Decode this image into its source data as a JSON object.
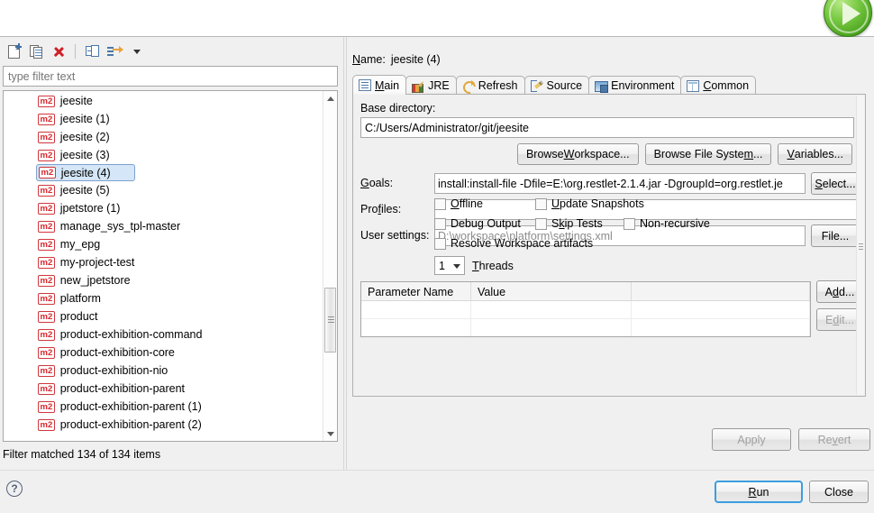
{
  "window": {
    "run_badge_icon": "green-run-play-icon"
  },
  "left_panel": {
    "toolbar": [
      {
        "name": "new-launch-configuration",
        "icon": "new-page-icon"
      },
      {
        "name": "duplicate-launch-configuration",
        "icon": "duplicate-icon"
      },
      {
        "name": "delete-launch-configuration",
        "icon": "delete-x-icon"
      },
      {
        "name": "collapse-all",
        "icon": "collapse-all-icon"
      },
      {
        "name": "filter-launch-configurations",
        "icon": "filter-arrow-icon"
      },
      {
        "name": "view-menu",
        "icon": "chevron-down-icon"
      }
    ],
    "filter": {
      "placeholder": "type filter text",
      "value": ""
    },
    "tree_items": [
      {
        "icon": "m2",
        "label": "jeesite",
        "selected": false
      },
      {
        "icon": "m2",
        "label": "jeesite (1)",
        "selected": false
      },
      {
        "icon": "m2",
        "label": "jeesite (2)",
        "selected": false
      },
      {
        "icon": "m2",
        "label": "jeesite (3)",
        "selected": false
      },
      {
        "icon": "m2",
        "label": "jeesite (4)",
        "selected": true
      },
      {
        "icon": "m2",
        "label": "jeesite (5)",
        "selected": false
      },
      {
        "icon": "m2",
        "label": "jpetstore (1)",
        "selected": false
      },
      {
        "icon": "m2",
        "label": "manage_sys_tpl-master",
        "selected": false
      },
      {
        "icon": "m2",
        "label": "my_epg",
        "selected": false
      },
      {
        "icon": "m2",
        "label": "my-project-test",
        "selected": false
      },
      {
        "icon": "m2",
        "label": "new_jpetstore",
        "selected": false
      },
      {
        "icon": "m2",
        "label": "platform",
        "selected": false
      },
      {
        "icon": "m2",
        "label": "product",
        "selected": false
      },
      {
        "icon": "m2",
        "label": "product-exhibition-command",
        "selected": false
      },
      {
        "icon": "m2",
        "label": "product-exhibition-core",
        "selected": false
      },
      {
        "icon": "m2",
        "label": "product-exhibition-nio",
        "selected": false
      },
      {
        "icon": "m2",
        "label": "product-exhibition-parent",
        "selected": false
      },
      {
        "icon": "m2",
        "label": "product-exhibition-parent (1)",
        "selected": false
      },
      {
        "icon": "m2",
        "label": "product-exhibition-parent (2)",
        "selected": false
      }
    ],
    "filter_status": "Filter matched 134 of 134 items"
  },
  "right_panel": {
    "name_label": "Name:",
    "name_value": "jeesite (4)",
    "tabs": [
      {
        "label": "Main",
        "icon": "main-clipboard-icon",
        "active": true
      },
      {
        "label": "JRE",
        "icon": "jre-books-icon",
        "active": false
      },
      {
        "label": "Refresh",
        "icon": "refresh-arrows-icon",
        "active": false
      },
      {
        "label": "Source",
        "icon": "source-pencil-icon",
        "active": false
      },
      {
        "label": "Environment",
        "icon": "environment-monitor-icon",
        "active": false
      },
      {
        "label": "Common",
        "icon": "common-table-icon",
        "active": false
      }
    ],
    "main_tab": {
      "base_directory_label": "Base directory:",
      "base_directory_value": "C:/Users/Administrator/git/jeesite",
      "browse_workspace_label": "Browse Workspace...",
      "browse_file_system_label": "Browse File System...",
      "variables_label": "Variables...",
      "goals_label": "Goals:",
      "goals_value": "install:install-file -Dfile=E:\\org.restlet-2.1.4.jar -DgroupId=org.restlet.je",
      "select_label": "Select...",
      "profiles_label": "Profiles:",
      "profiles_value": "",
      "user_settings_label": "User settings:",
      "user_settings_value": "D:\\workspace\\platform\\settings.xml",
      "file_label": "File...",
      "checkboxes": [
        {
          "label": "Offline",
          "checked": false
        },
        {
          "label": "Update Snapshots",
          "checked": false
        },
        {
          "label": "Debug Output",
          "checked": false
        },
        {
          "label": "Skip Tests",
          "checked": false
        },
        {
          "label": "Non-recursive",
          "checked": false
        },
        {
          "label": "Resolve Workspace artifacts",
          "checked": false
        }
      ],
      "threads_value": "1",
      "threads_label": "Threads",
      "parameter_table": {
        "columns": [
          "Parameter Name",
          "Value",
          ""
        ],
        "rows": [
          [
            "",
            "",
            ""
          ],
          [
            "",
            "",
            ""
          ]
        ]
      },
      "add_label": "Add...",
      "edit_label": "Edit..."
    },
    "apply_label": "Apply",
    "revert_label": "Revert"
  },
  "bottom_bar": {
    "help_icon": "help-question-icon",
    "run_label": "Run",
    "close_label": "Close"
  }
}
